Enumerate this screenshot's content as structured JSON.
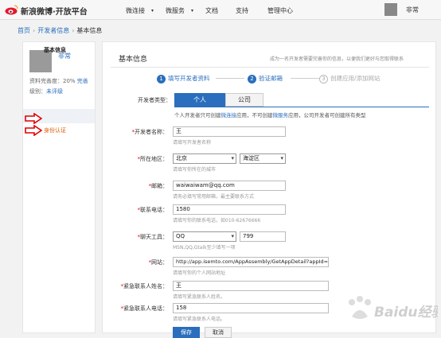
{
  "topbar": {
    "logo_text": "新浪微博·开放平台",
    "nav": [
      "微连接",
      "微服务",
      "文档",
      "支持",
      "管理中心"
    ],
    "username": "非常"
  },
  "breadcrumb": [
    "首页",
    "开发者信息",
    "基本信息"
  ],
  "sidebar": {
    "name": "非常",
    "completeness_label": "资料完善度：20%",
    "completeness_link": "完善",
    "level_label": "级别：",
    "level_value": "未评级",
    "items": [
      {
        "label": "基本信息",
        "active": true
      },
      {
        "label": "身份认证",
        "active": false
      }
    ]
  },
  "main": {
    "title": "基本信息",
    "description": "成为一名开发者需要完善你的信息，以便我们更好与您取得联系",
    "steps": [
      {
        "num": "1",
        "label": "填写开发者资料"
      },
      {
        "num": "2",
        "label": "验证邮箱"
      },
      {
        "num": "3",
        "label": "创建应用/添加网站"
      }
    ],
    "type_label": "开发者类型：",
    "tabs": [
      "个人",
      "公司"
    ],
    "type_note_parts": [
      "个人开发者只可创建",
      "微连接",
      "应用，不可创建",
      "微服务",
      "应用，公司开发者可创建所有类型"
    ],
    "fields": [
      {
        "label": "开发者名称：",
        "required": true,
        "value": "王",
        "hint": "请填写开发者名称"
      },
      {
        "label": "所在地区：",
        "required": true,
        "province": "北京",
        "district": "海淀区",
        "hint": "请填写你所在的城市"
      },
      {
        "label": "邮箱：",
        "required": true,
        "value": "waiwaiwam@qq.com",
        "hint": "请务必填写常用邮箱，最主要联系方式"
      },
      {
        "label": "联系电话：",
        "required": true,
        "value": "1580",
        "hint": "请填写你的联系电话，如010-62676666"
      },
      {
        "label": "聊天工具：",
        "required": true,
        "tool": "QQ",
        "value": "799",
        "hint": "MSN,QQ,Gtalk至少填写一项"
      },
      {
        "label": "网站：",
        "required": true,
        "value": "http://app.isemto.com/AppAssembly/GetAppDetail?appId=1d0734",
        "hint": "请填写你的个人网站地址"
      },
      {
        "label": "紧急联系人姓名：",
        "required": true,
        "value": "王",
        "hint": "请填写紧急联系人姓名。"
      },
      {
        "label": "紧急联系人电话：",
        "required": true,
        "value": "158",
        "hint": "请填写紧急联系人电话。"
      }
    ],
    "save_label": "保存",
    "cancel_label": "取消"
  },
  "watermark_text": "Baidu经验",
  "colors": {
    "accent": "#2a6ebd",
    "arrow": "#e00000",
    "link_orange": "#e05a00"
  }
}
